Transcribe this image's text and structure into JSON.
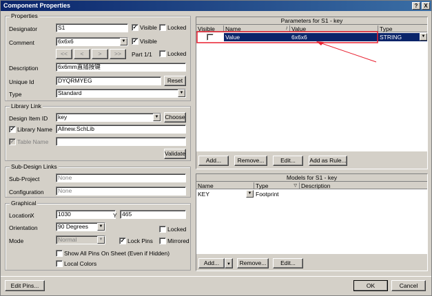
{
  "window": {
    "title": "Component Properties",
    "help_btn": "?",
    "close_btn": "X"
  },
  "properties": {
    "group_title": "Properties",
    "designator_label": "Designator",
    "designator_value": "S1",
    "designator_visible_label": "Visible",
    "designator_visible_checked": "✓",
    "designator_locked_label": "Locked",
    "comment_label": "Comment",
    "comment_value": "6x6x6",
    "comment_visible_label": "Visible",
    "comment_visible_checked": "✓",
    "nav_first": "<<",
    "nav_prev": "<",
    "nav_next": ">",
    "nav_last": ">>",
    "part_label": "Part 1/1",
    "part_locked_label": "Locked",
    "description_label": "Description",
    "description_value": "6x6mm直插按键",
    "unique_id_label": "Unique Id",
    "unique_id_value": "DYQRMYEG",
    "reset_button": "Reset",
    "type_label": "Type",
    "type_value": "Standard"
  },
  "library_link": {
    "group_title": "Library Link",
    "design_item_label": "Design Item ID",
    "design_item_value": "key",
    "choose_button": "Choose",
    "library_name_label": "Library Name",
    "library_name_checked": "✓",
    "library_name_value": "Allnew.SchLib",
    "table_name_label": "Table Name",
    "table_name_checked": "✓",
    "validate_button": "Validate"
  },
  "sub_design": {
    "group_title": "Sub-Design Links",
    "sub_project_label": "Sub-Project",
    "sub_project_value": "None",
    "configuration_label": "Configuration",
    "configuration_value": "None"
  },
  "graphical": {
    "group_title": "Graphical",
    "location_label": "Location",
    "x_label": "X",
    "x_value": "1030",
    "y_label": "Y",
    "y_value": "465",
    "orientation_label": "Orientation",
    "orientation_value": "90 Degrees",
    "locked_label": "Locked",
    "mode_label": "Mode",
    "mode_value": "Normal",
    "lock_pins_label": "Lock Pins",
    "lock_pins_checked": "✓",
    "mirrored_label": "Mirrored",
    "show_pins_label": "Show All Pins On Sheet (Even if Hidden)",
    "local_colors_label": "Local Colors"
  },
  "parameters": {
    "title": "Parameters for S1 - key",
    "col_visible": "Visible",
    "col_name": "Name",
    "col_value": "Value",
    "col_type": "Type",
    "row": {
      "name": "Value",
      "value": "6x6x6",
      "type": "STRING"
    },
    "add_button": "Add...",
    "remove_button": "Remove...",
    "edit_button": "Edit...",
    "add_rule_button": "Add as Rule..."
  },
  "models": {
    "title": "Models for S1 - key",
    "col_name": "Name",
    "col_type": "Type",
    "col_description": "Description",
    "row": {
      "name": "KEY",
      "type": "Footprint",
      "description": ""
    },
    "add_button": "Add...",
    "remove_button": "Remove...",
    "edit_button": "Edit..."
  },
  "footer": {
    "edit_pins_button": "Edit Pins...",
    "ok_button": "OK",
    "cancel_button": "Cancel"
  },
  "colors": {
    "selection": "#0a246a",
    "annotation": "#e81c2c",
    "dialog_bg": "#d4d0c8"
  }
}
